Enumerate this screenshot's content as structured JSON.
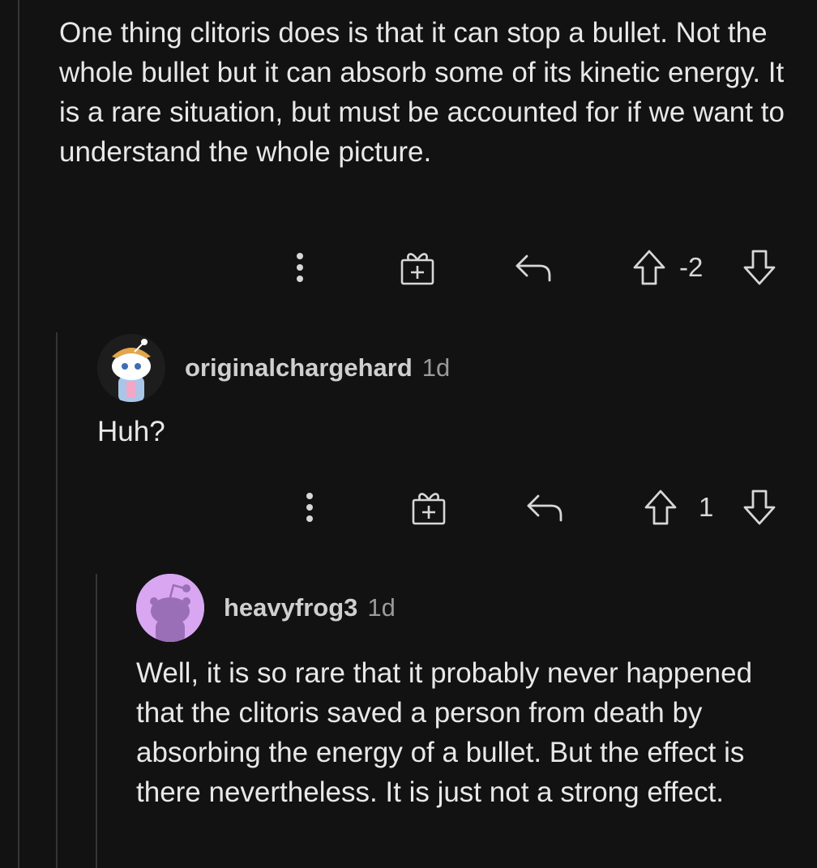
{
  "comments": [
    {
      "text": "One thing clitoris does is that it can stop a bullet. Not the whole bullet but it can absorb some of its kinetic energy. It is a rare situation, but must be accounted for if we want to understand the whole picture.",
      "score": "-2",
      "icons": [
        "more-vertical-icon",
        "gift-icon",
        "reply-icon",
        "upvote-icon",
        "downvote-icon"
      ]
    },
    {
      "username": "originalchargehard",
      "age": "1d",
      "text": "Huh?",
      "score": "1",
      "avatar_bg": "#1b1b1b"
    },
    {
      "username": "heavyfrog3",
      "age": "1d",
      "text": "Well, it is so rare that it probably never happened that the clitoris saved a person from death by absorbing the energy of a bullet. But the effect is there nevertheless. It is just not a strong effect.",
      "avatar_bg": "#d9a6f2"
    }
  ],
  "colors": {
    "background": "#121212",
    "text": "#e8e8e8",
    "muted": "#9a9a9a",
    "thread_line": "#343536"
  }
}
